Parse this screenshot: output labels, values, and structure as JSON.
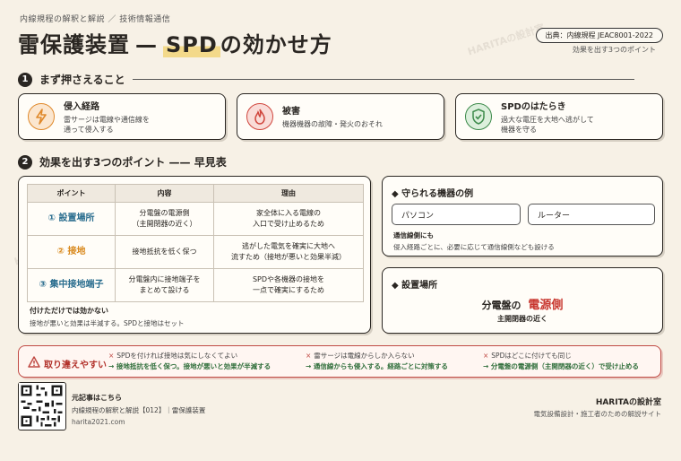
{
  "header": {
    "series": "内線規程の解釈と解説 ／ 技術情報通信",
    "title_pre": "雷保護装置",
    "title_dash": "—",
    "title_hl": "SPD",
    "title_post": "の効かせ方",
    "source_badge": "出典：内線規程 JEAC8001-2022",
    "source_sub": "効果を出す3つのポイント"
  },
  "section1": {
    "num": "1",
    "title": "まず押さえること",
    "cards": [
      {
        "title": "侵入経路",
        "desc": "雷サージは電線や通信線を\n通って侵入する",
        "icon": "lightning-icon",
        "color": "#e0892b"
      },
      {
        "title": "被害",
        "desc": "機器機器の故障・発火のおそれ",
        "icon": "flame-icon",
        "color": "#d0453c"
      },
      {
        "title": "SPDのはたらき",
        "desc": "過大な電圧を大地へ逃がして\n機器を守る",
        "icon": "shield-check-icon",
        "color": "#3c8a4a"
      }
    ]
  },
  "section2": {
    "num": "2",
    "title": "効果を出す3つのポイント —— 早見表",
    "headers": [
      "ポイント",
      "内容",
      "理由"
    ],
    "rows": [
      {
        "point": "① 設置場所",
        "color": "#2b6e8f",
        "content": "分電盤の電源側\n（主開閉器の近く）",
        "reason": "家全体に入る電線の\n入口で受け止めるため"
      },
      {
        "point": "② 接地",
        "color": "#d98a1f",
        "content": "接地抵抗を低く保つ",
        "reason": "逃がした電気を確実に大地へ\n流すため（接地が悪いと効果半減）"
      },
      {
        "point": "③ 集中接地端子",
        "color": "#2b6e8f",
        "content": "分電盤内に接地端子を\nまとめて設ける",
        "reason": "SPDや各機器の接地を\n一点で確実にするため"
      }
    ],
    "note_title": "付けただけでは効かない",
    "note_desc": "接地が悪いと効果は半減する。SPDと接地はセット"
  },
  "protected": {
    "title": "守られる機器の例",
    "devices": [
      "パソコン",
      "ルーター"
    ],
    "comm_title": "通信線側にも",
    "comm_desc": "侵入経路ごとに、必要に応じて通信線側なども設ける"
  },
  "location": {
    "title": "設置場所",
    "line_pre": "分電盤の",
    "line_hl": "電源側",
    "line_sub": "主開閉器の近く",
    "hl_color": "#c8362e"
  },
  "warnings": {
    "label": "取り違えやすい",
    "items": [
      {
        "wrong": "SPDを付ければ接地は気にしなくてよい",
        "right": "接地抵抗を低く保つ。接地が悪いと効果が半減する"
      },
      {
        "wrong": "雷サージは電線からしか入らない",
        "right": "通信線からも侵入する。経路ごとに対策する"
      },
      {
        "wrong": "SPDはどこに付けても同じ",
        "right": "分電盤の電源側（主開閉器の近く）で受け止める"
      }
    ]
  },
  "footer": {
    "title": "元記事はこちら",
    "desc": "内線規程の解釈と解説【012】｜雷保護装置",
    "url": "harita2021.com",
    "brand": "HARITAの設計室",
    "brand_sub": "電気設備設計・施工者のための解説サイト",
    "watermark": "HARITAの設計室"
  }
}
